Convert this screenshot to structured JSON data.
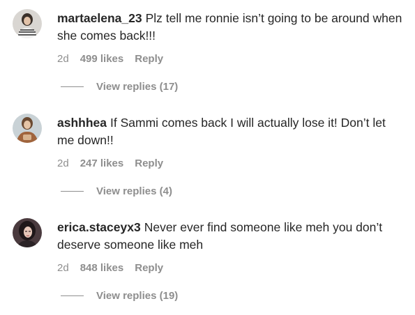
{
  "comments": [
    {
      "username": "martaelena_23",
      "text": "Plz tell me ronnie isn’t going to be around when she comes back!!!",
      "time": "2d",
      "likes": "499 likes",
      "reply": "Reply",
      "view_replies": "View replies (17)"
    },
    {
      "username": "ashhhea",
      "text": "If Sammi comes back I will actually lose it! Don’t let me down!!",
      "time": "2d",
      "likes": "247 likes",
      "reply": "Reply",
      "view_replies": "View replies (4)"
    },
    {
      "username": "erica.staceyx3",
      "text": "Never ever find someone like meh you don’t deserve someone like meh",
      "time": "2d",
      "likes": "848 likes",
      "reply": "Reply",
      "view_replies": "View replies (19)"
    }
  ]
}
